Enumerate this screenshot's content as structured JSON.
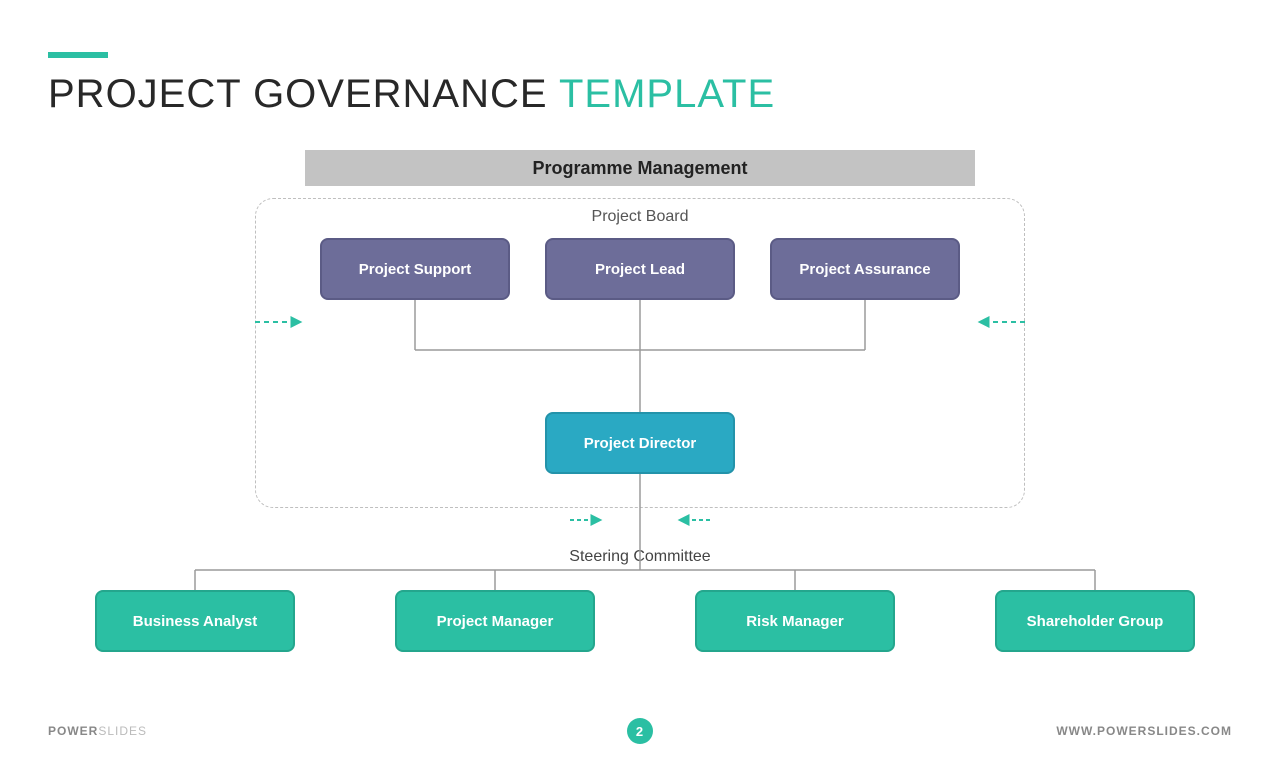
{
  "title": {
    "main": "PROJECT GOVERNANCE ",
    "accent": "TEMPLATE"
  },
  "header_bar": "Programme Management",
  "board_label": "Project Board",
  "board_boxes": [
    "Project Support",
    "Project Lead",
    "Project Assurance"
  ],
  "director": "Project Director",
  "steering_label": "Steering Committee",
  "steering_boxes": [
    "Business Analyst",
    "Project Manager",
    "Risk Manager",
    "Shareholder Group"
  ],
  "footer": {
    "brand_bold": "POWER",
    "brand_light": "SLIDES",
    "url": "WWW.POWERSLIDES.COM",
    "page": "2"
  },
  "colors": {
    "accent": "#2bbfa3",
    "purple": "#6d6d99",
    "teal": "#2aa9c3"
  }
}
